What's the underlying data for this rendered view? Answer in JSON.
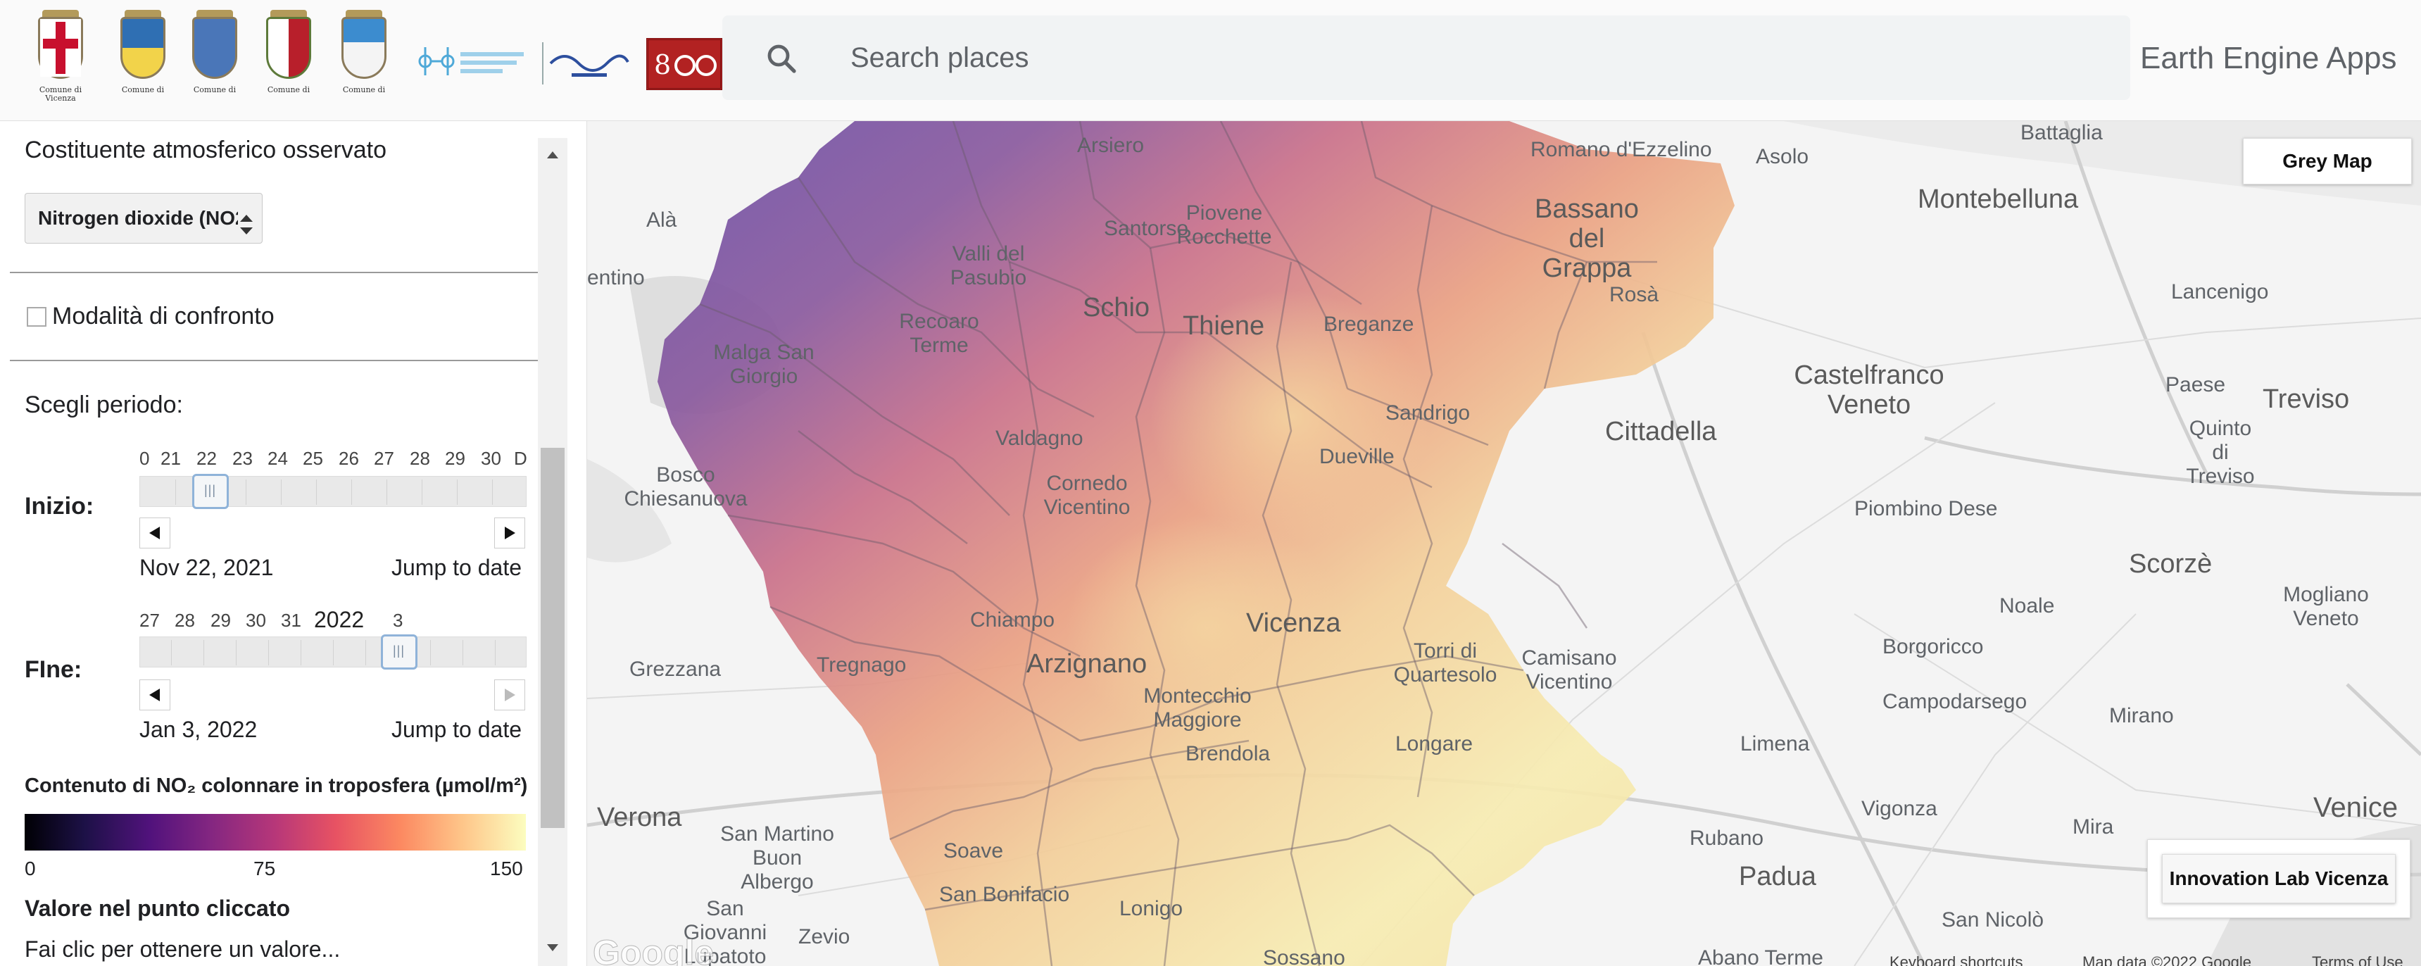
{
  "header": {
    "crests": [
      {
        "name": "Comune di Vicenza"
      },
      {
        "name": "Comune di"
      },
      {
        "name": "Comune di"
      },
      {
        "name": "Comune di"
      },
      {
        "name": "Comune di"
      }
    ],
    "search_placeholder": "Search places",
    "app_title": "Earth Engine Apps"
  },
  "sidebar": {
    "pollutant_heading": "Costituente atmosferico osservato",
    "pollutant_value": "Nitrogen dioxide (NO2",
    "compare_label": "Modalità di confronto",
    "period_label": "Scegli periodo:",
    "start": {
      "label": "Inizio:",
      "ticks": [
        "0",
        "21",
        "22",
        "23",
        "24",
        "25",
        "26",
        "27",
        "28",
        "29",
        "30",
        "D"
      ],
      "date": "Nov 22, 2021",
      "jump": "Jump to date"
    },
    "end": {
      "label": "FIne:",
      "ticks": [
        "27",
        "28",
        "29",
        "30",
        "31",
        "2022",
        "3"
      ],
      "date": "Jan 3, 2022",
      "jump": "Jump to date"
    },
    "legend_title": "Contenuto di NO₂ colonnare in troposfera (µmol/m²)",
    "legend_min": "0",
    "legend_mid": "75",
    "legend_max": "150",
    "legend_palette": [
      "#000004",
      "#51127c",
      "#b73779",
      "#fc8961",
      "#fcfdbf"
    ],
    "click_value_title": "Valore nel punto cliccato",
    "click_value_text": "Fai clic per ottenere un valore..."
  },
  "map": {
    "grey_map_button": "Grey Map",
    "innovation_button": "Innovation Lab Vicenza",
    "places": [
      {
        "name": "Arsiero"
      },
      {
        "name": "Romano d'Ezzelino"
      },
      {
        "name": "Battaglia"
      },
      {
        "name": "Asolo"
      },
      {
        "name": "Montebelluna"
      },
      {
        "name": "Alà"
      },
      {
        "name": "Piovene Rocchette"
      },
      {
        "name": "Bassano del Grappa"
      },
      {
        "name": "Valli del Pasubio"
      },
      {
        "name": "Santorso"
      },
      {
        "name": "Rosà"
      },
      {
        "name": "Lancenigo"
      },
      {
        "name": "entino"
      },
      {
        "name": "Schio"
      },
      {
        "name": "Recoaro Terme"
      },
      {
        "name": "Thiene"
      },
      {
        "name": "Breganze"
      },
      {
        "name": "Malga San Giorgio"
      },
      {
        "name": "Castelfranco Veneto"
      },
      {
        "name": "Paese"
      },
      {
        "name": "Treviso"
      },
      {
        "name": "Sandrigo"
      },
      {
        "name": "Quinto di Treviso"
      },
      {
        "name": "Cittadella"
      },
      {
        "name": "Valdagno"
      },
      {
        "name": "Dueville"
      },
      {
        "name": "Bosco Chiesanuova"
      },
      {
        "name": "Cornedo Vicentino"
      },
      {
        "name": "Piombino Dese"
      },
      {
        "name": "Scorzè"
      },
      {
        "name": "Mogliano Veneto"
      },
      {
        "name": "Noale"
      },
      {
        "name": "Chiampo"
      },
      {
        "name": "Vicenza"
      },
      {
        "name": "Borgoricco"
      },
      {
        "name": "Tregnago"
      },
      {
        "name": "Grezzana"
      },
      {
        "name": "Torri di Quartesolo"
      },
      {
        "name": "Arzignano"
      },
      {
        "name": "Camisano Vicentino"
      },
      {
        "name": "Campodarsego"
      },
      {
        "name": "Montecchio Maggiore"
      },
      {
        "name": "Mirano"
      },
      {
        "name": "Longare"
      },
      {
        "name": "Limena"
      },
      {
        "name": "Brendola"
      },
      {
        "name": "Verona"
      },
      {
        "name": "Vigonza"
      },
      {
        "name": "Venice"
      },
      {
        "name": "San Martino Buon Albergo"
      },
      {
        "name": "Soave"
      },
      {
        "name": "Rubano"
      },
      {
        "name": "Mira"
      },
      {
        "name": "Padua"
      },
      {
        "name": "San Bonifacio"
      },
      {
        "name": "Lonigo"
      },
      {
        "name": "San Giovanni Lupatoto"
      },
      {
        "name": "Zevio"
      },
      {
        "name": "Sossano"
      },
      {
        "name": "San Nicolò"
      },
      {
        "name": "Abano Terme"
      }
    ],
    "attribution": {
      "keyboard": "Keyboard shortcuts",
      "mapdata": "Map data ©2022 Google",
      "terms": "Terms of Use"
    }
  }
}
